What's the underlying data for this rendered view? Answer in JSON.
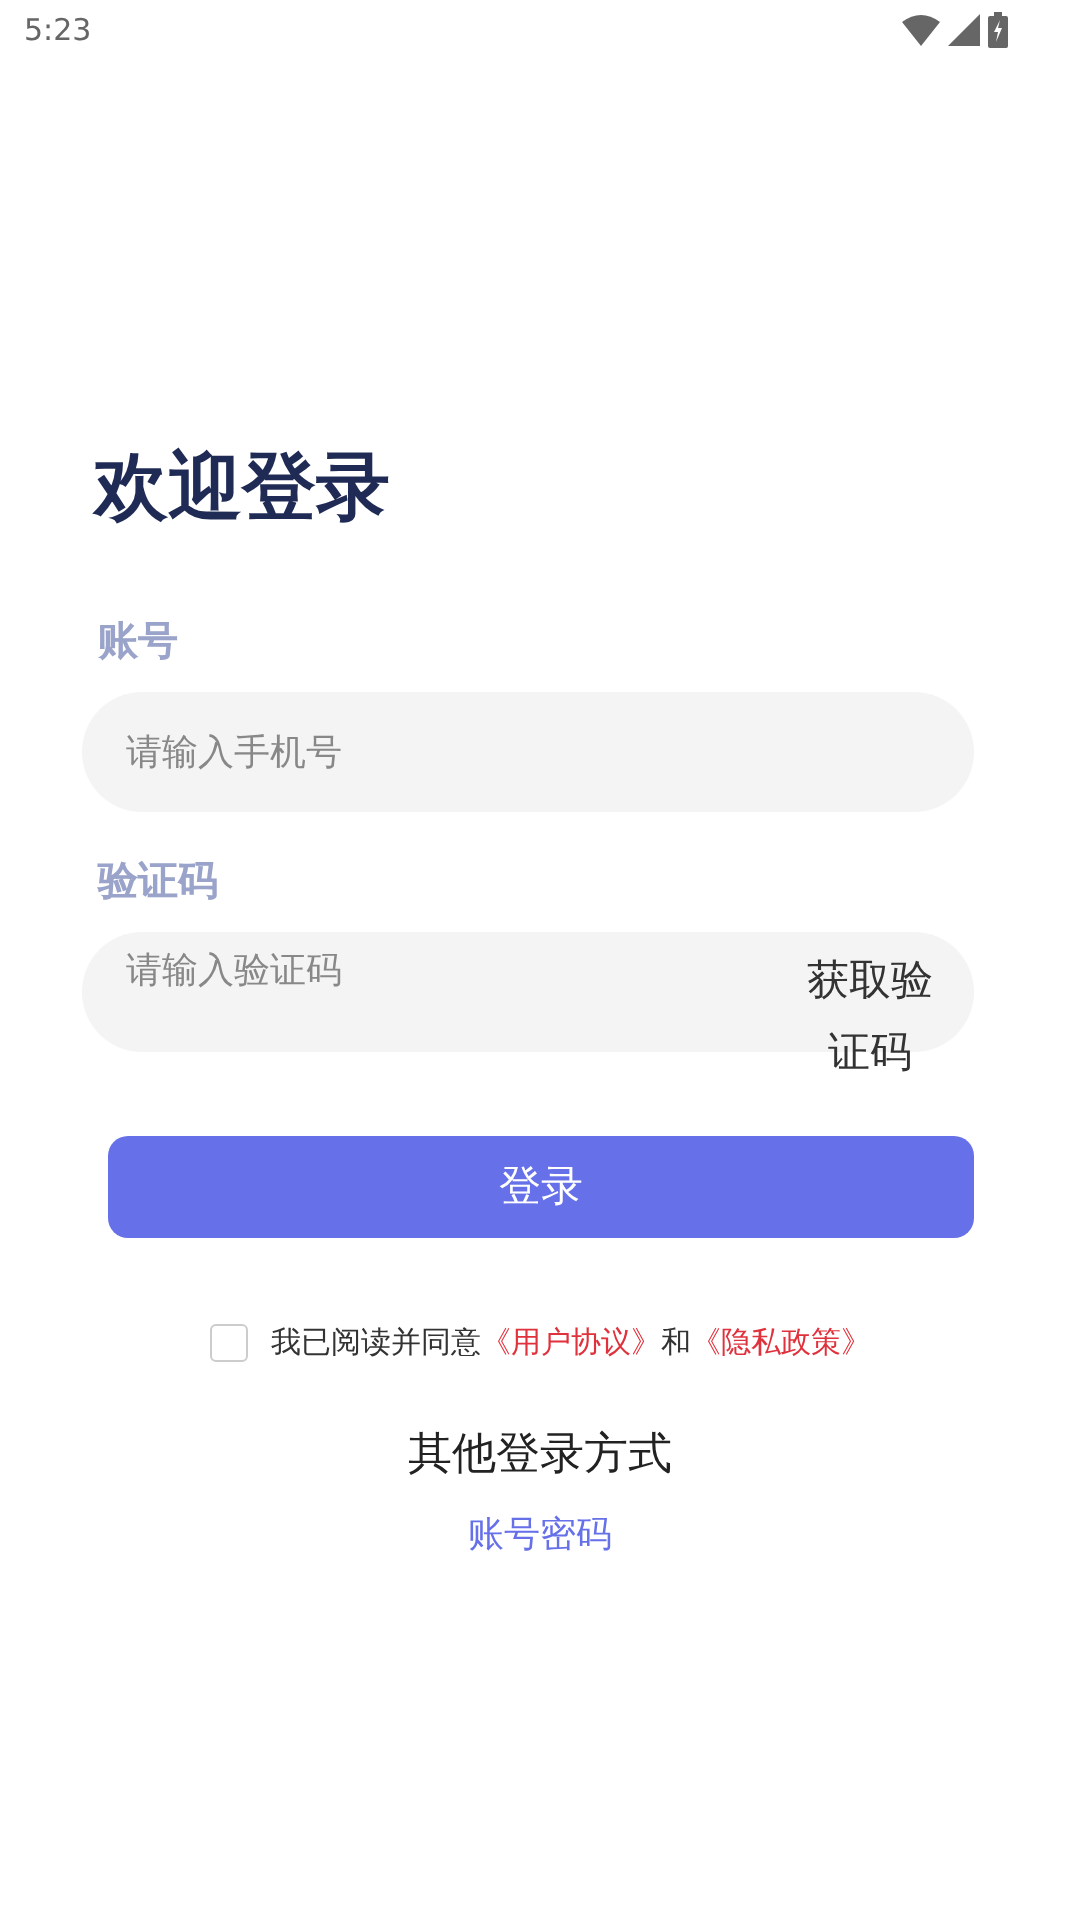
{
  "status_bar": {
    "time": "5:23"
  },
  "title": "欢迎登录",
  "account": {
    "label": "账号",
    "placeholder": "请输入手机号"
  },
  "code": {
    "label": "验证码",
    "placeholder": "请输入验证码",
    "button": "获取验证码"
  },
  "login_button": "登录",
  "agreement": {
    "checked": false,
    "parts": [
      {
        "kind": "text",
        "text": "我已阅读并同意"
      },
      {
        "kind": "link",
        "text": "《用户协议》"
      },
      {
        "kind": "text",
        "text": "和"
      },
      {
        "kind": "link",
        "text": "《隐私政策》"
      }
    ]
  },
  "other_title": "其他登录方式",
  "other_link": "账号密码"
}
